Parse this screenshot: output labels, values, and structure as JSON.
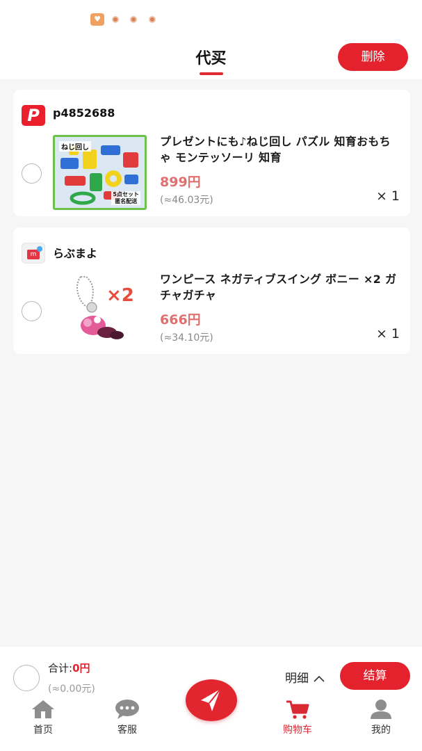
{
  "status_bar": {
    "app_icon": "heart-app-icon",
    "dots": [
      "notification-dot",
      "notification-dot",
      "notification-dot"
    ]
  },
  "header": {
    "title": "代买",
    "delete_label": "删除"
  },
  "cart": {
    "items": [
      {
        "shop_logo": "paypay-logo",
        "shop_logo_text": "P",
        "shop_name": "p4852688",
        "image_label": "ねじ回し",
        "image_label_2": "5点セット\n匿名配送",
        "title": "プレゼントにも♪ねじ回し パズル 知育おもちゃ モンテッソーリ 知育",
        "price": "899円",
        "price_rmb": "(≈46.03元)",
        "quantity": "× 1"
      },
      {
        "shop_logo": "mercari-logo",
        "shop_logo_text": "m",
        "shop_name": "らぶまよ",
        "image_label": "×2",
        "title": "ワンピース ネガティブスイング ボニー ×2 ガチャガチャ",
        "price": "666円",
        "price_rmb": "(≈34.10元)",
        "quantity": "× 1"
      }
    ]
  },
  "summary": {
    "total_label": "合计:",
    "total_value": "0円",
    "total_rmb": "(≈0.00元)",
    "detail_label": "明细",
    "checkout_label": "结算"
  },
  "nav": [
    {
      "label": "首页",
      "icon": "home-icon"
    },
    {
      "label": "客服",
      "icon": "chat-icon"
    },
    {
      "label": "",
      "icon": "send-icon"
    },
    {
      "label": "购物车",
      "icon": "cart-icon",
      "active": true
    },
    {
      "label": "我的",
      "icon": "user-icon"
    }
  ],
  "colors": {
    "accent": "#e3222d",
    "price": "#e07070",
    "background": "#f6f6f6"
  }
}
